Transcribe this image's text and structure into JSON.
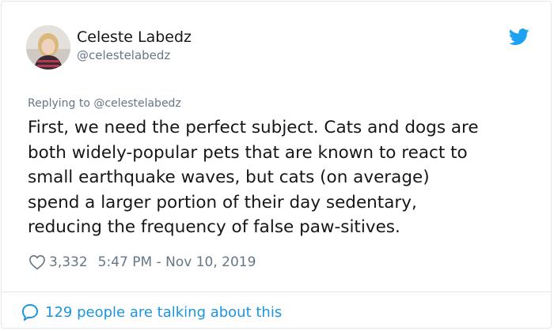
{
  "author": {
    "name": "Celeste Labedz",
    "handle": "@celestelabedz"
  },
  "reply": {
    "text": "Replying to @celestelabedz"
  },
  "tweet": {
    "lines": [
      "First, we need the perfect subject. Cats and dogs are",
      "both widely-popular pets that are known to react to",
      "small earthquake waves, but cats (on average)",
      "spend a larger portion of their day sedentary,",
      "reducing the frequency of false paw-sitives."
    ]
  },
  "meta": {
    "likes": "3,332",
    "timestamp": "5:47 PM - Nov 10, 2019"
  },
  "footer": {
    "talking": "129 people are talking about this"
  },
  "icons": {
    "brand": "twitter-bird-icon",
    "like": "heart-outline-icon",
    "conversation": "speech-bubble-icon"
  },
  "colors": {
    "brand": "#1da1f2",
    "link": "#1b95e0",
    "secondary_text": "#657786",
    "border": "#e1e8ed"
  }
}
